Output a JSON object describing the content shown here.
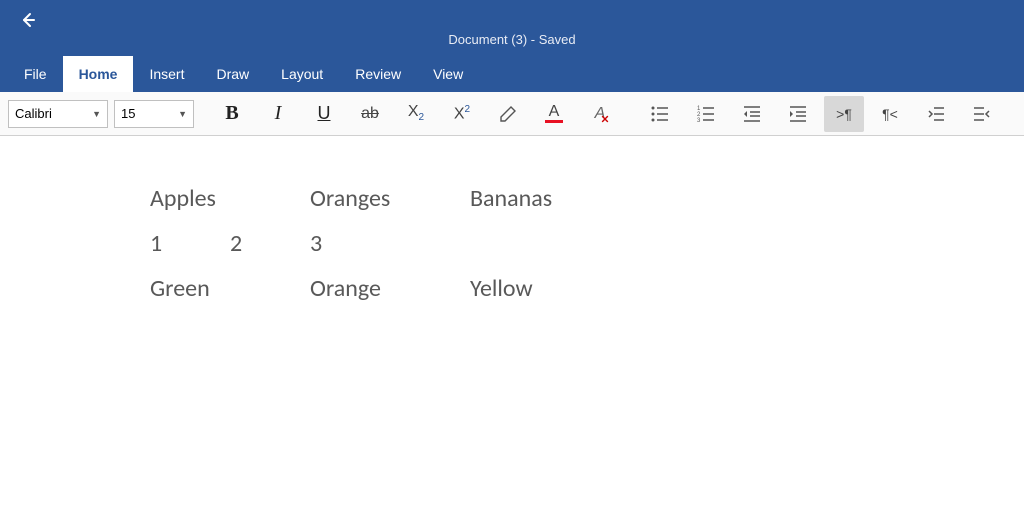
{
  "header": {
    "title": "Document (3) - Saved"
  },
  "tabs": {
    "file": "File",
    "home": "Home",
    "insert": "Insert",
    "draw": "Draw",
    "layout": "Layout",
    "review": "Review",
    "view": "View"
  },
  "toolbar": {
    "font_name": "Calibri",
    "font_size": "15"
  },
  "document": {
    "row1_c1": "Apples",
    "row1_c2": "Oranges",
    "row1_c3": "Bananas",
    "row2_c1": "1",
    "row2_c2": "2",
    "row2_c3": "3",
    "row3_c1": "Green",
    "row3_c2": "Orange",
    "row3_c3": "Yellow"
  }
}
